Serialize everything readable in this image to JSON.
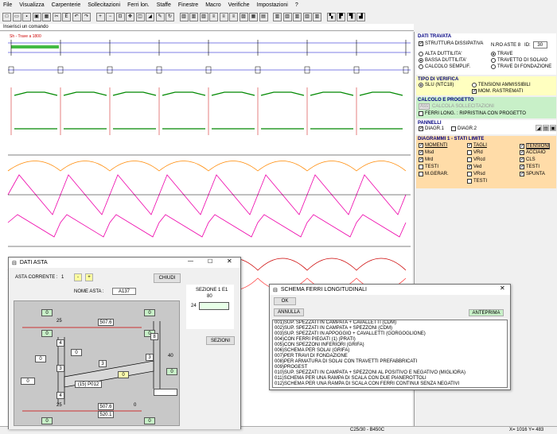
{
  "menu": [
    "File",
    "Visualizza",
    "Carpenterie",
    "Sollecitazioni",
    "Ferri lon.",
    "Staffe",
    "Finestre",
    "Macro",
    "Verifiche",
    "Impostazioni",
    "?"
  ],
  "toolbar_icons": [
    "new-icon",
    "open-icon",
    "save-icon",
    "save-as-icon",
    "print-icon",
    "cut-icon",
    "exe-icon",
    "undo-icon",
    "redo-icon",
    "zoom-in-icon",
    "zoom-out-icon",
    "zoom-window-icon",
    "pan-icon",
    "zoom-all-icon",
    "erase-icon",
    "draw-icon",
    "regen-icon",
    "frame1-icon",
    "frame2-icon",
    "frame3-icon",
    "beam-icon",
    "beam2-icon",
    "beam3-icon",
    "section-icon",
    "grid-icon",
    "table-icon",
    "reinforce1-icon",
    "reinforce2-icon",
    "reinforce3-icon",
    "reinforce4-icon",
    "reinforce5-icon",
    "chart1-icon",
    "chart2-icon",
    "chart3-icon",
    "chart4-icon"
  ],
  "command_prompt": "Inserisci un comando",
  "drawing_label": "Sh - Trave a 1800",
  "right": {
    "dati_trave": {
      "title": "DATI TRAVATA",
      "struttura": "STRUTTURA DISSIPATIVA",
      "n_aste_label": "N.RO ASTE",
      "n_aste": "8",
      "id_label": "ID:",
      "id_value": "30",
      "alta": "ALTA DUTTILITA'",
      "bassa": "BASSA DUTTILITA'",
      "calcolo": "CALCOLO SEMPLIF.",
      "trave": "TRAVE",
      "travetto": "TRAVETTO DI SOLAIO",
      "fondazione": "TRAVE DI FONDAZIONE"
    },
    "tipo": {
      "title": "TIPO DI VERIFICA",
      "slu": "SLU (NTC18)",
      "tensioni": "TENSIONI AMMISSIBILI",
      "mom": "MOM. RASTREMATI"
    },
    "calcolo": {
      "title": "CALCOLO E PROGETTO",
      "btn": "Ass",
      "calc": "CALCOLA SOLLECITAZIONI",
      "ferri": "FERRI LONG. : RIPRISTINA CON PROGETTO"
    },
    "pannelli": {
      "title": "PANNELLI",
      "d1": "DIAGR.1",
      "d2": "DIAGR.2"
    },
    "diagrammi": {
      "title": "DIAGRAMMI 1 - STATI LIMITE",
      "momenti": "MOMENTI",
      "tagli": "TAGLI",
      "tensioni_h": "TENSIONI",
      "msd": "Msd",
      "vsd": "VRd",
      "acciaio": "ACCIAIO",
      "mrd": "Mrd",
      "vrcd": "VRcd",
      "cls": "CLS",
      "testi1": "TESTI",
      "ved": "Ved",
      "testi3": "TESTI",
      "mgerar": "M.GERAR.",
      "vrd2": "VRsd",
      "spunta": "SPUNTA",
      "testi2": "TESTI"
    }
  },
  "status": {
    "material": "C25/30 - B450C",
    "coords": "X= 1016 Y= 483"
  },
  "dati_asta": {
    "title": "DATI ASTA",
    "asta_corrente_label": "ASTA CORRENTE :",
    "asta_corrente": "1",
    "minus": "-",
    "plus": "+",
    "chiudi": "CHIUDI",
    "nome_label": "NOME ASTA :",
    "nome": "A137",
    "sezione_label": "SEZIONE 1 E1",
    "sezione_val": "80",
    "sezioni": "SEZIONI",
    "v_0a": "0",
    "v_0b": "0",
    "v_25a": "25",
    "v_507a": "507.6",
    "v_0c": "0",
    "v_0d": "0",
    "v_4a": "4",
    "v_0e": "0",
    "v_8": "8",
    "v_0f": "0",
    "v_3a": "3",
    "v_3b": "3",
    "v_3c": "3",
    "v_40": "40",
    "v_0g": "0",
    "v_0h": "0",
    "v_0i": "0",
    "v_p012": "(15) P012",
    "v_4b": "4",
    "v_25b": "25",
    "v_507b": "507.6",
    "v_0j": "0",
    "v_520": "520.1",
    "v_0k": "0",
    "v_0l": "0",
    "v_0m": "0",
    "v_24": "24"
  },
  "schema": {
    "title": "SCHEMA FERRI LONGITUDINALI",
    "ok": "OK",
    "annulla": "ANNULLA",
    "anteprima": "ANTEPRIMA",
    "items": [
      "001)SUP. SPEZZATI IN CAMPATA + CAVALLETTI (CDM)",
      "002)SUP. SPEZZATI IN CAMPATA + SPEZZONI (CDM)",
      "003)SUP. SPEZZATI IN APPOGGIO + CAVALLETTI (GORGOGLIONE)",
      "004)CON FERRI PIEGATI (1) (PRATI)",
      "005)CON SPEZZONI INFERIORI (GRIFA)",
      "006)SCHEMA PER SOLAI (GRIFA)",
      "007)PER TRAVI DI FONDAZIONE",
      "008)PER ARMATURA DI SOLAI CON TRAVETTI PREFABBRICATI",
      "009)PROGEST",
      "010)SUP. SPEZZATI IN CAMPATA + SPEZZONI AL POSITIVO E NEGATIVO (MIGLIORA)",
      "011)SCHEMA PER UNA RAMPA DI SCALA CON DUE PIANEROTTOLI",
      "012)SCHEMA PER UNA RAMPA DI SCALA CON FERRI CONTINUI SENZA NEGATIVI"
    ]
  }
}
